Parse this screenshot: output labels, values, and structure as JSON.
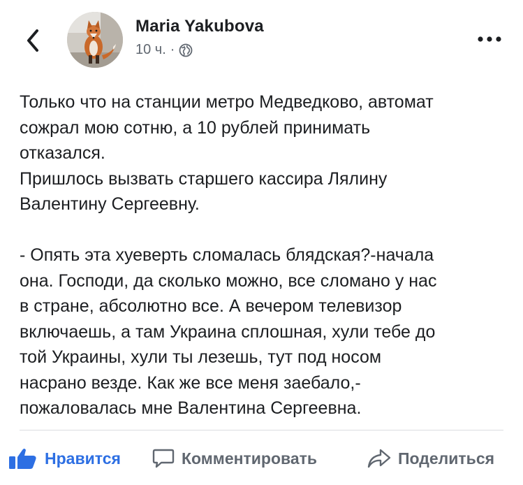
{
  "header": {
    "author_name": "Maria Yakubova",
    "time": "10 ч.",
    "separator": "·",
    "privacy_icon": "globe-icon",
    "more_icon": "more-dots-icon",
    "back_icon": "chevron-left-icon"
  },
  "post": {
    "paragraphs": [
      "Только что на станции метро Медведково, автомат\nсожрал мою сотню, а 10 рублей принимать\nотказался.",
      "Пришлось вызвать старшего кассира Лялину\nВалентину Сергеевну.",
      "- Опять эта хуеверть сломалась блядская?-начала\nона. Господи, да сколько можно, все сломано у нас\nв стране, абсолютно все. А вечером телевизор\nвключаешь, а там Украина сплошная, хули тебе до\nтой Украины, хули ты лезешь, тут под носом\nнасрано везде. Как же все меня заебало,-\nпожаловалась мне Валентина Сергеевна."
    ]
  },
  "actions": {
    "like_label": "Нравится",
    "comment_label": "Комментировать",
    "share_label": "Поделиться"
  },
  "colors": {
    "like_active": "#2d6fe3",
    "muted": "#606770",
    "text": "#1c1e21"
  }
}
